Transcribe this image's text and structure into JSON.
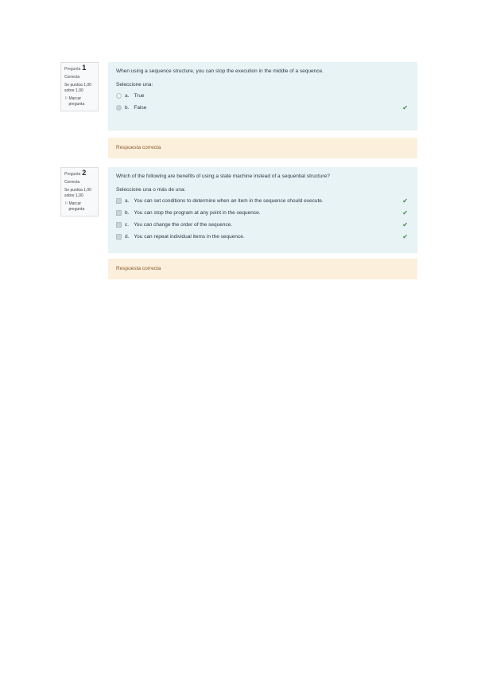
{
  "questions": [
    {
      "label": "Pregunta",
      "number": "1",
      "state": "Correcta",
      "grade": "Se puntúa 1,00 sobre 1,00",
      "flag_label": "Marcar pregunta",
      "text": "When using a sequence structure, you can stop the execution in the middle of a sequence.",
      "prompt": "Seleccione una:",
      "options": [
        {
          "letter": "a.",
          "text": "True"
        },
        {
          "letter": "b.",
          "text": "False"
        }
      ],
      "feedback": "Respuesta correcta"
    },
    {
      "label": "Pregunta",
      "number": "2",
      "state": "Correcta",
      "grade": "Se puntúa 1,00 sobre 1,00",
      "flag_label": "Marcar pregunta",
      "text": "Which of the following are benefits of using a state machine instead of a sequential structure?",
      "prompt": "Seleccione una o más de una:",
      "options": [
        {
          "letter": "a.",
          "text": "You can set conditions to determine when an item in the sequence should execute."
        },
        {
          "letter": "b.",
          "text": "You can stop the program at any point in the sequence."
        },
        {
          "letter": "c.",
          "text": "You can change the order of the sequence."
        },
        {
          "letter": "d.",
          "text": "You can repeat individual items in the sequence."
        }
      ],
      "feedback": "Respuesta correcta"
    }
  ],
  "icons": {
    "check": "check-icon",
    "flag": "flag-icon"
  },
  "colors": {
    "formulation_bg": "#e7f3f5",
    "feedback_bg": "#fcefdc",
    "check": "#3a8a3a"
  }
}
